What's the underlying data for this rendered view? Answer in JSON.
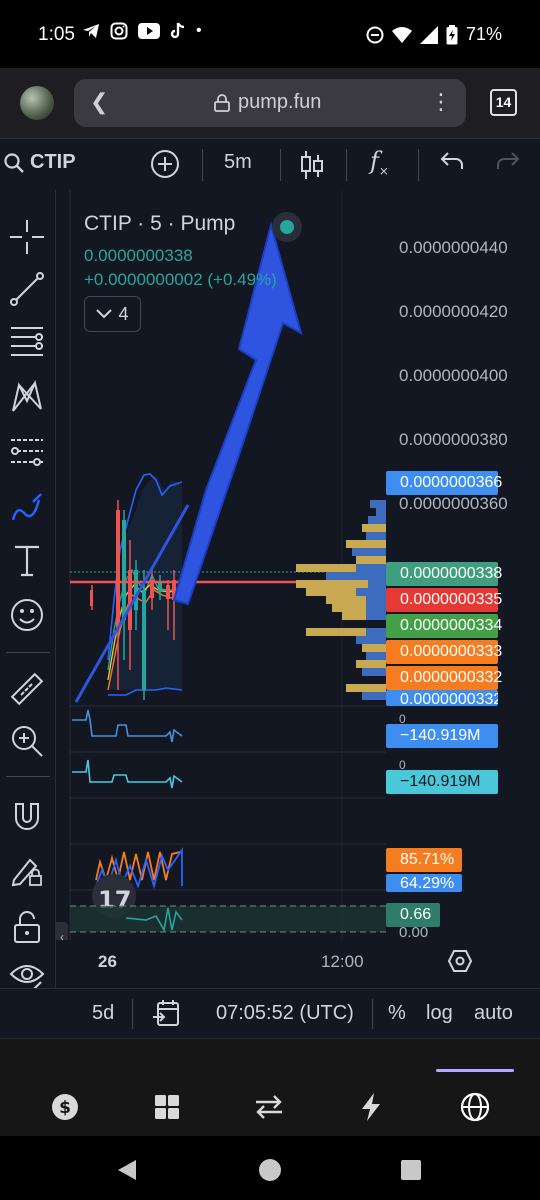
{
  "status_bar": {
    "time": "1:05",
    "battery": "71%",
    "icons": [
      "telegram-icon",
      "instagram-icon",
      "youtube-icon",
      "tiktok-icon",
      "dot-icon",
      "dnd-icon",
      "wifi-icon",
      "signal-icon",
      "battery-icon"
    ]
  },
  "browser": {
    "url": "pump.fun",
    "tab_count": "14"
  },
  "toolbar": {
    "symbol": "CTIP",
    "interval": "5m"
  },
  "chart": {
    "legend_title": "CTIP · 5 · Pump",
    "legend_price": "0.0000000338",
    "legend_change": "+0.0000000002 (+0.49%)",
    "indicators_count": "4",
    "price_axis": [
      "0.0000000440",
      "0.0000000420",
      "0.0000000400",
      "0.0000000380",
      "0.0000000360"
    ],
    "price_tags": [
      {
        "label": "0.0000000366",
        "color": "#3d8ef0"
      },
      {
        "label": "0.0000000338",
        "color": "#3f9e7e"
      },
      {
        "label": "0.0000000335",
        "color": "#e53935"
      },
      {
        "label": "0.0000000334",
        "color": "#43a047"
      },
      {
        "label": "0.0000000333",
        "color": "#f57c1f"
      },
      {
        "label": "0.0000000332",
        "color": "#f57c1f"
      },
      {
        "label": "0.0000000332",
        "color": "#3d8ef0"
      }
    ],
    "volume_zero_1": "0",
    "volume_tag_1": "−140.919M",
    "volume_zero_2": "0",
    "volume_tag_2": "−140.919M",
    "osc_tag_1": "85.71%",
    "osc_tag_2": "64.29%",
    "osc_tag_3": "0.66",
    "osc_zero": "0.00",
    "time_labels": [
      "26",
      "12:00"
    ]
  },
  "range_bar": {
    "range": "5d",
    "clock": "07:05:52 (UTC)",
    "percent": "%",
    "log": "log",
    "auto": "auto"
  },
  "colors": {
    "background": "#131722",
    "up": "#26a69a",
    "down": "#ef5350",
    "arrow": "#2f55e0"
  }
}
